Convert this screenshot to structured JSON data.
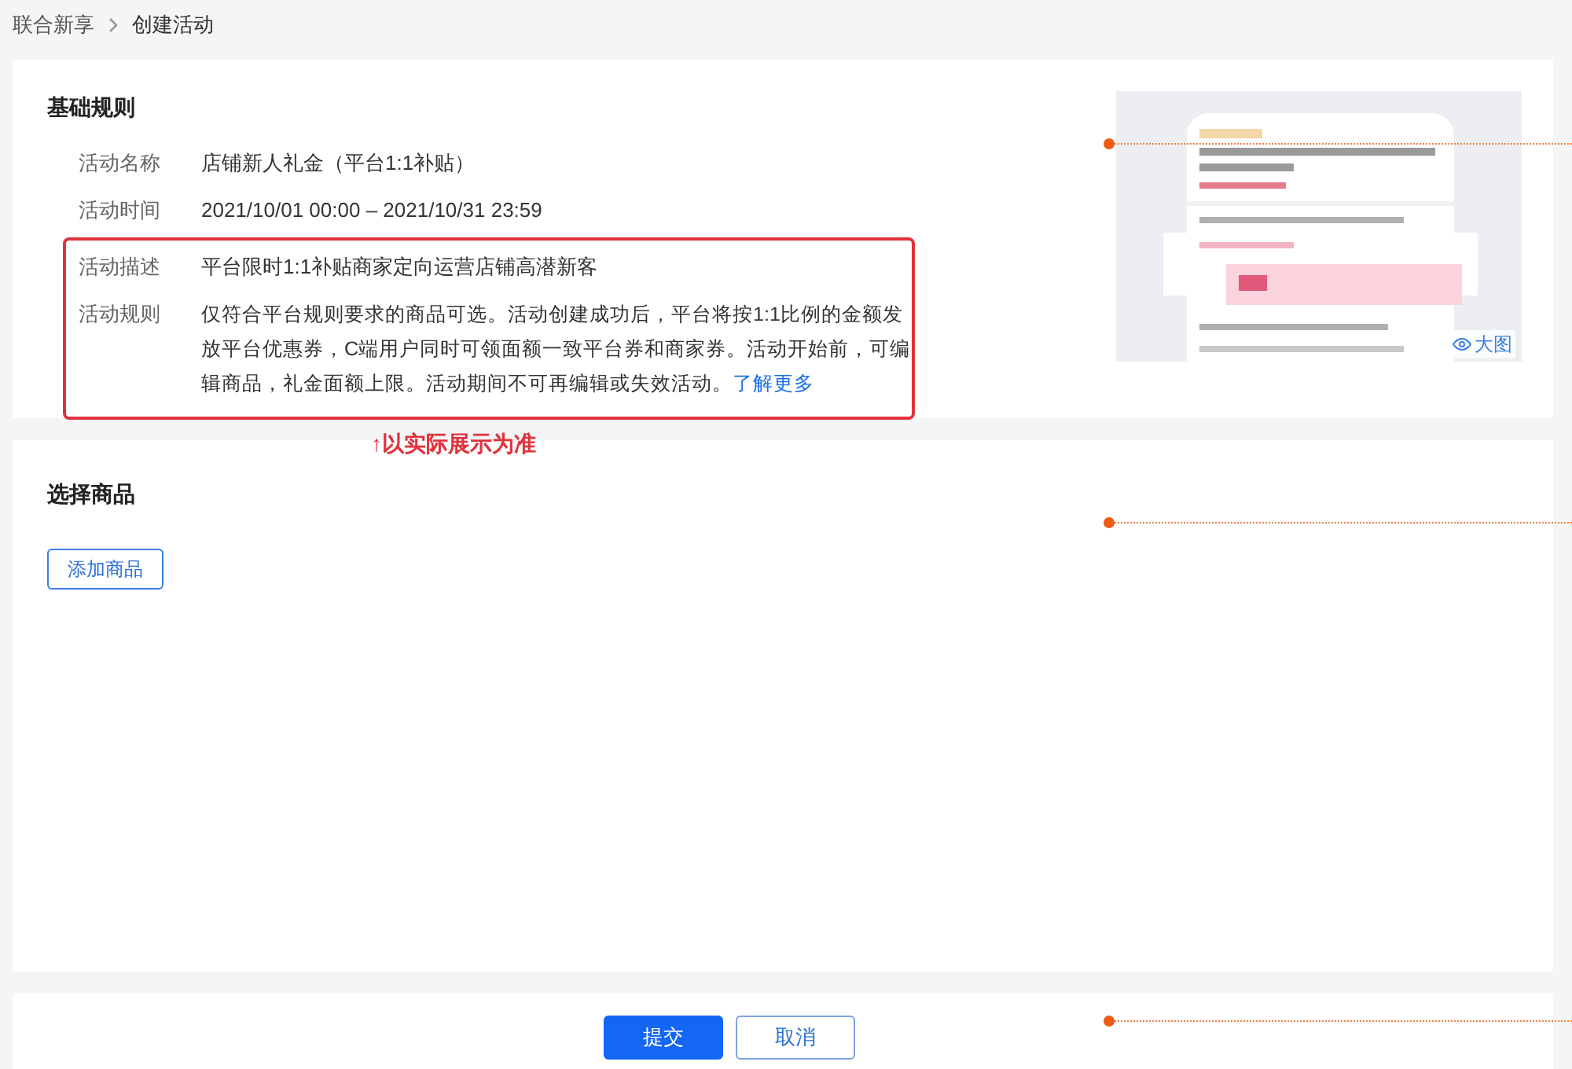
{
  "breadcrumb": [
    "联合新享",
    "创建活动"
  ],
  "basic_rules": {
    "title": "基础规则",
    "fields": [
      {
        "label": "活动名称",
        "value": "店铺新人礼金（平台1:1补贴）",
        "highlighted": false
      },
      {
        "label": "活动时间",
        "value": "2021/10/01 00:00 – 2021/10/31 23:59",
        "highlighted": false
      },
      {
        "label": "活动描述",
        "value": "平台限时1:1补贴商家定向运营店铺高潜新客",
        "highlighted": true
      },
      {
        "label": "活动规则",
        "value": "仅符合平台规则要求的商品可选。活动创建成功后，平台将按1:1比例的金额发放平台优惠券，C端用户同时可领面额一致平台券和商家券。活动开始前，可编辑商品，礼金面额上限。活动期间不可再编辑或失效活动。",
        "link": "了解更多",
        "highlighted": true
      }
    ],
    "preview": {
      "button": "大图"
    }
  },
  "annotation": "↑以实际展示为准",
  "products": {
    "title": "选择商品",
    "button": "添加商品"
  },
  "actions": [
    {
      "label": "提交",
      "kind": "primary"
    },
    {
      "label": "取消",
      "kind": "secondary"
    }
  ]
}
